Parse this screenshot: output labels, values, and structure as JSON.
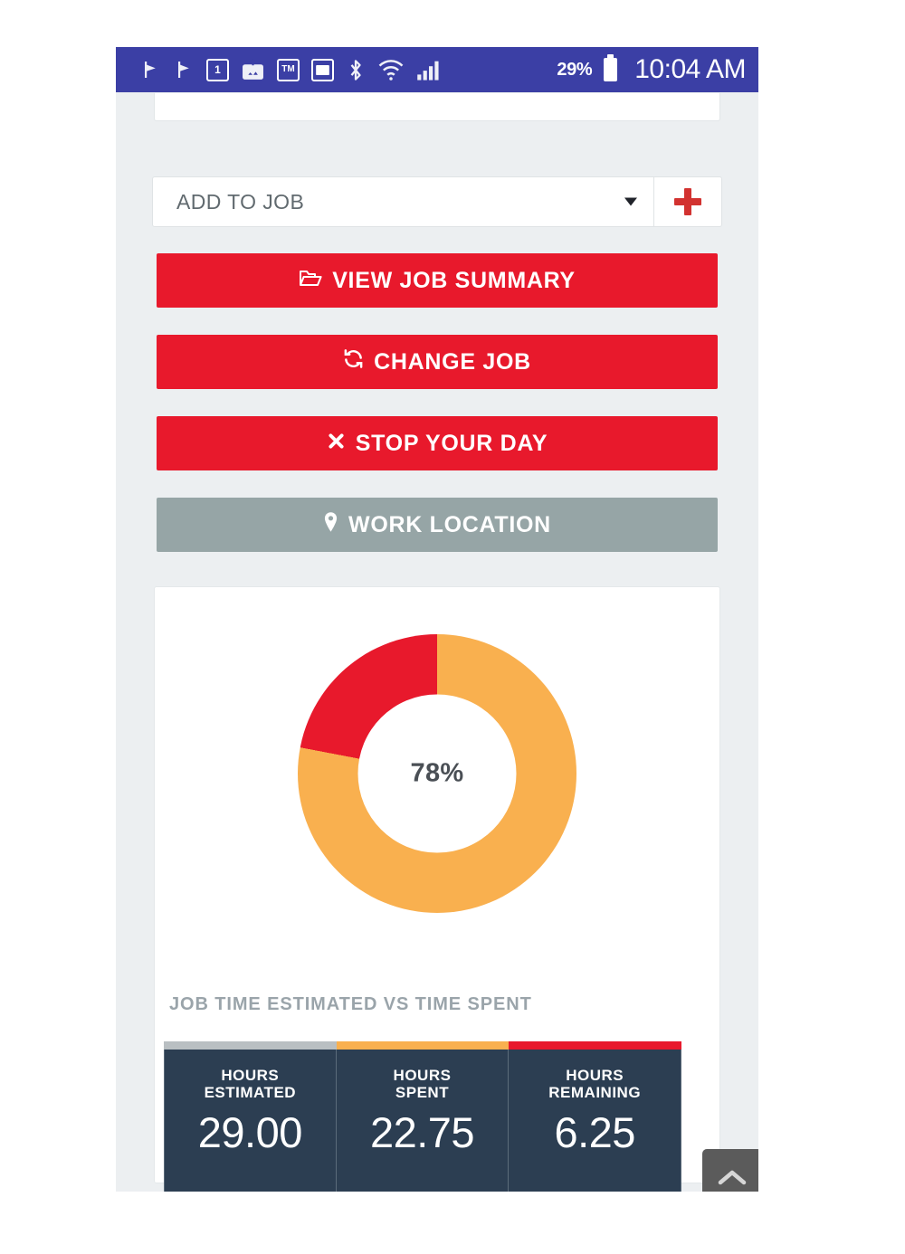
{
  "statusbar": {
    "icons": [
      {
        "name": "flag-pin-icon",
        "glyph": "flag"
      },
      {
        "name": "flag-pin-icon",
        "glyph": "flag"
      },
      {
        "name": "calendar-icon",
        "glyph": "1"
      },
      {
        "name": "photo-upload-icon",
        "glyph": "photo"
      },
      {
        "name": "tm-icon",
        "glyph": "TM"
      },
      {
        "name": "screenshot-icon",
        "glyph": "screen"
      },
      {
        "name": "bluetooth-icon",
        "glyph": "bluetooth"
      },
      {
        "name": "wifi-icon",
        "glyph": "wifi"
      },
      {
        "name": "cellular-signal-icon",
        "glyph": "signal"
      }
    ],
    "battery_percent": "29%",
    "clock": "10:04 AM"
  },
  "add_to_job": {
    "selected": "ADD TO JOB",
    "caret_icon": "chevron-down-icon",
    "add_icon": "plus-icon"
  },
  "actions": [
    {
      "id": "view-job-summary",
      "label": "VIEW JOB SUMMARY",
      "icon": "folder-open-icon",
      "style": "red"
    },
    {
      "id": "change-job",
      "label": "CHANGE JOB",
      "icon": "refresh-icon",
      "style": "red"
    },
    {
      "id": "stop-your-day",
      "label": "STOP YOUR DAY",
      "icon": "close-x-icon",
      "style": "red"
    },
    {
      "id": "work-location",
      "label": "WORK LOCATION",
      "icon": "map-pin-icon",
      "style": "gray"
    }
  ],
  "chart_title": "JOB TIME ESTIMATED VS TIME SPENT",
  "chart_data": {
    "type": "pie",
    "title": "JOB TIME ESTIMATED VS TIME SPENT",
    "center_label": "78%",
    "labels": [
      "Hours Spent",
      "Hours Remaining"
    ],
    "values": [
      78,
      22
    ],
    "colors": [
      "#f9b04f",
      "#e8192c"
    ],
    "donut": true,
    "start_angle": 0,
    "legend": "none"
  },
  "stats": [
    {
      "label_line1": "HOURS",
      "label_line2": "ESTIMATED",
      "value": "29.00",
      "bar_color": "#b9bfc2"
    },
    {
      "label_line1": "HOURS",
      "label_line2": "SPENT",
      "value": "22.75",
      "bar_color": "#f9b04f"
    },
    {
      "label_line1": "HOURS",
      "label_line2": "REMAINING",
      "value": "6.25",
      "bar_color": "#e8192c"
    }
  ],
  "scroll_top": {
    "icon": "chevron-up-icon"
  },
  "colors": {
    "statusbar": "#3b3fa5",
    "page_bg": "#eceff1",
    "accent_red": "#e8192c",
    "accent_orange": "#f9b04f",
    "muted_gray": "#96a5a6",
    "card_navy": "#2c3e52"
  }
}
